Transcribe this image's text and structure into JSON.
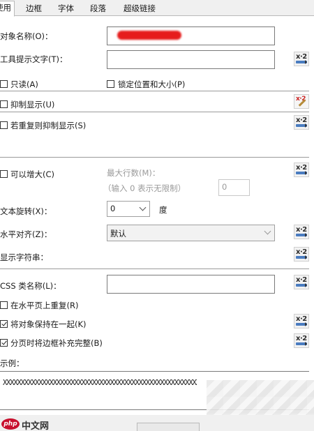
{
  "tabs": [
    {
      "label": "使用"
    },
    {
      "label": "边框"
    },
    {
      "label": "字体"
    },
    {
      "label": "段落"
    },
    {
      "label": "超级链接"
    }
  ],
  "fields": {
    "object_name_label": "对象名称(O)：",
    "tooltip_label": "工具提示文字(T)：",
    "tooltip_value": "",
    "readonly_label": "只读(A)",
    "readonly_checked": false,
    "lock_label": "锁定位置和大小(P)",
    "lock_checked": false,
    "suppress_label": "抑制显示(U)",
    "suppress_checked": false,
    "suppress_dup_label": "若重复则抑制显示(S)",
    "suppress_dup_checked": false,
    "can_grow_label": "可以增大(C)",
    "can_grow_checked": false,
    "max_lines_label": "最大行数(M)：",
    "max_lines_hint": "（输入 0 表示无限制）",
    "max_lines_value": "0",
    "rotation_label": "文本旋转(X)：",
    "rotation_value": "0",
    "rotation_unit": "度",
    "halign_label": "水平对齐(Z)：",
    "halign_value": "默认",
    "display_string_label": "显示字符串：",
    "css_label": "CSS 类名称(L)：",
    "css_value": "",
    "repeat_h_label": "在水平页上重复(R)",
    "repeat_h_checked": false,
    "keep_together_label": "将对象保持在一起(K)",
    "keep_together_checked": true,
    "close_border_label": "分页时将边框补充完整(B)",
    "close_border_checked": true,
    "sample_label": "示例：",
    "sample_text": "XXXXXXXXXXXXXXXXXXXXXXXXXXXXXXXXXXXXXXXXXXXXXXXXXXXXXXXX"
  },
  "icons": {
    "formula_button": "formula-icon",
    "formula_button_active": "formula-pencil-icon"
  },
  "watermark": {
    "text": "中文网",
    "brand": "php"
  },
  "colors": {
    "accent": "#4a7cc0",
    "redaction": "#e61c1c",
    "watermark_red": "#c8102e"
  }
}
